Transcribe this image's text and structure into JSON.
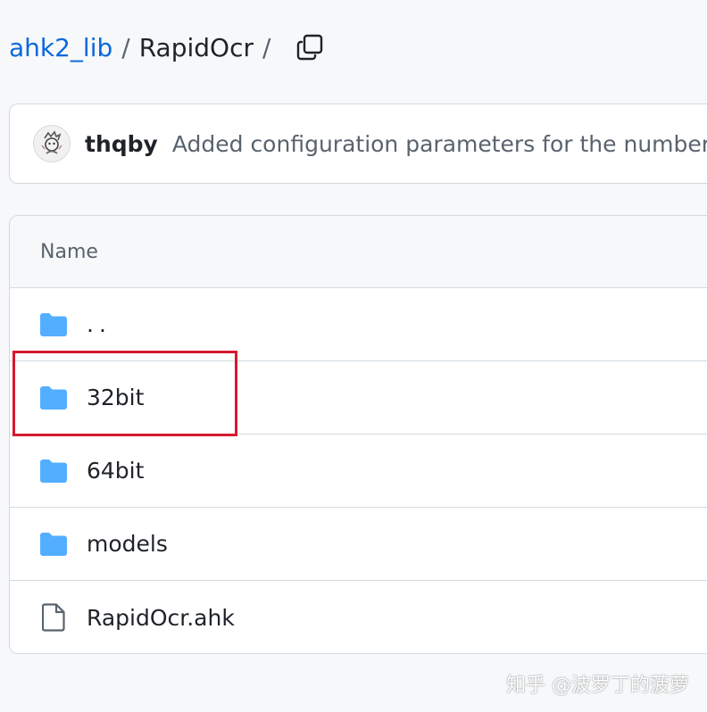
{
  "breadcrumb": {
    "repo": "ahk2_lib",
    "separator": "/",
    "folder": "RapidOcr",
    "trailing_separator": "/"
  },
  "commit": {
    "author": "thqby",
    "message": "Added configuration parameters for the number of"
  },
  "table": {
    "header": "Name",
    "rows": [
      {
        "name": "..",
        "type": "folder",
        "icon": "folder-icon"
      },
      {
        "name": "32bit",
        "type": "folder",
        "icon": "folder-icon",
        "highlighted": true
      },
      {
        "name": "64bit",
        "type": "folder",
        "icon": "folder-icon"
      },
      {
        "name": "models",
        "type": "folder",
        "icon": "folder-icon"
      },
      {
        "name": "RapidOcr.ahk",
        "type": "file",
        "icon": "file-icon"
      }
    ]
  },
  "watermark": "知乎 @波罗丁的菠萝",
  "colors": {
    "link": "#0969da",
    "folder": "#54aeff",
    "highlight": "#d7192f",
    "border": "#d1d9e0"
  }
}
